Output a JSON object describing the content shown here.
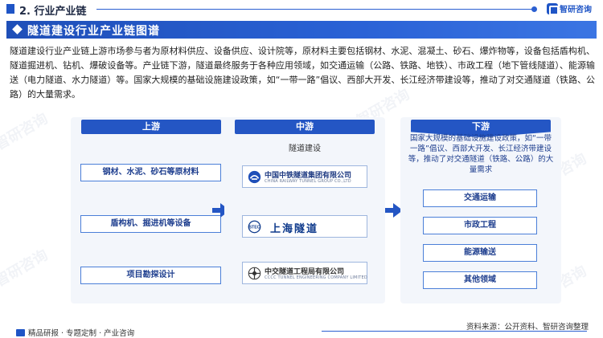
{
  "header": {
    "section_title": "2. 行业产业链",
    "brand": "智研咨询"
  },
  "banner": {
    "title": "隧道建设行业产业链图谱"
  },
  "intro": {
    "text": "隧道建设行业产业链上游市场参与者为原材料供应、设备供应、设计院等，原材料主要包括钢材、水泥、混凝土、砂石、爆炸物等，设备包括盾构机、隧道掘进机、钻机、爆破设备等。产业链下游，隧道最终服务于各种应用领域，如交通运输（公路、铁路、地铁）、市政工程（地下管线隧道）、能源输送（电力隧道、水力隧道）等。国家大规模的基础设施建设政策，如“一带一路”倡议、西部大开发、长江经济带建设等，推动了对交通隧道（铁路、公路）的大量需求。"
  },
  "upstream": {
    "title": "上游",
    "items": [
      "钢材、水泥、砂石等原材料",
      "盾构机、掘进机等设备",
      "项目勘探设计"
    ]
  },
  "midstream": {
    "title": "中游",
    "subtitle": "隧道建设",
    "companies": [
      {
        "name": "中国中铁隧道集团有限公司",
        "name_en": "CHINA RAILWAY TUNNEL GROUP CO.,LTD"
      },
      {
        "name": "上海隧道",
        "badge": "STEC"
      },
      {
        "name": "中交隧道工程局有限公司",
        "name_en": "CCCC TUNNEL ENGINEERING COMPANY LIMITED"
      }
    ]
  },
  "downstream": {
    "title": "下游",
    "description": "国家大规模的基础设施建设政策，如“一带一路”倡议、西部大开发、长江经济带建设等，推动了对交通隧道（铁路、公路）的大量需求",
    "items": [
      "交通运输",
      "市政工程",
      "能源输送",
      "其他领域"
    ]
  },
  "footer": {
    "left": "精品研报 · 专题定制 · 产业咨询",
    "source": "资料来源：公开资料、智研咨询整理"
  },
  "watermark": "智研咨询",
  "colors": {
    "primary": "#2456c4",
    "banner": "#1f4fb8",
    "panel": "#f3f6fb"
  }
}
